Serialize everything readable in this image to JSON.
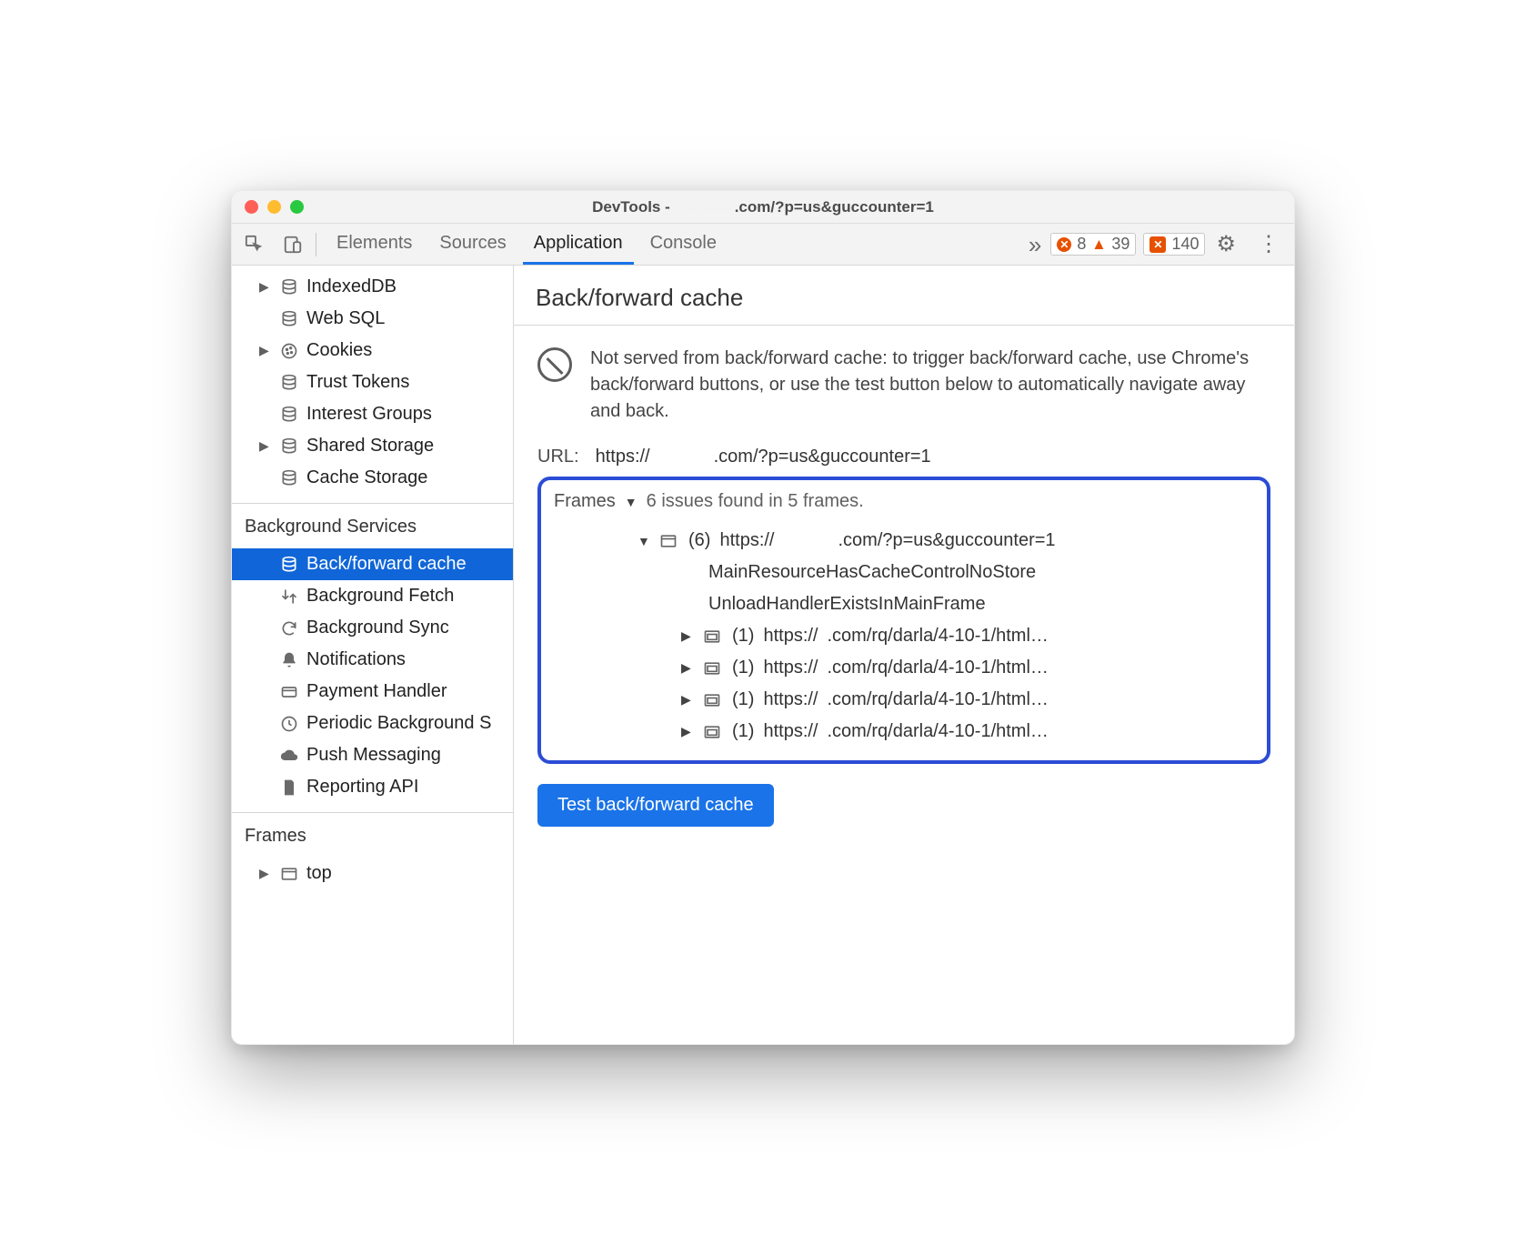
{
  "titlebar": {
    "prefix": "DevTools - ",
    "hidden_host": "xxxxxxx",
    "suffix": ".com/?p=us&guccounter=1"
  },
  "toolbar": {
    "tabs": [
      "Elements",
      "Sources",
      "Application",
      "Console"
    ],
    "active_tab": "Application",
    "counts": {
      "errors": "8",
      "warnings": "39",
      "messages": "140"
    }
  },
  "sidebar": {
    "storage_items": [
      {
        "label": "IndexedDB",
        "icon": "db",
        "expandable": true
      },
      {
        "label": "Web SQL",
        "icon": "db",
        "expandable": false
      },
      {
        "label": "Cookies",
        "icon": "cookie",
        "expandable": true
      },
      {
        "label": "Trust Tokens",
        "icon": "db",
        "expandable": false
      },
      {
        "label": "Interest Groups",
        "icon": "db",
        "expandable": false
      },
      {
        "label": "Shared Storage",
        "icon": "db",
        "expandable": true
      },
      {
        "label": "Cache Storage",
        "icon": "db",
        "expandable": false
      }
    ],
    "bg_section": "Background Services",
    "bg_items": [
      {
        "label": "Back/forward cache",
        "icon": "db",
        "selected": true
      },
      {
        "label": "Background Fetch",
        "icon": "fetch"
      },
      {
        "label": "Background Sync",
        "icon": "sync"
      },
      {
        "label": "Notifications",
        "icon": "bell"
      },
      {
        "label": "Payment Handler",
        "icon": "card"
      },
      {
        "label": "Periodic Background Sync",
        "icon": "clock",
        "truncate": "Periodic Background S"
      },
      {
        "label": "Push Messaging",
        "icon": "cloud"
      },
      {
        "label": "Reporting API",
        "icon": "doc"
      }
    ],
    "frames_section": "Frames",
    "frames_items": [
      {
        "label": "top",
        "icon": "frame",
        "expandable": true
      }
    ]
  },
  "content": {
    "title": "Back/forward cache",
    "notice": "Not served from back/forward cache: to trigger back/forward cache, use Chrome's back/forward buttons, or use the test button below to automatically navigate away and back.",
    "url_label": "URL:",
    "url_prefix": "https://",
    "url_hidden": "xxxxxxx",
    "url_suffix": ".com/?p=us&guccounter=1",
    "issues": {
      "frames_label": "Frames",
      "summary": "6 issues found in 5 frames.",
      "root": {
        "count": "(6)",
        "url_prefix": "https://",
        "url_hidden": "xxxxxxx",
        "url_suffix": ".com/?p=us&guccounter=1",
        "reasons": [
          "MainResourceHasCacheControlNoStore",
          "UnloadHandlerExistsInMainFrame"
        ],
        "children": [
          {
            "count": "(1)",
            "url_prefix": "https://",
            "url_hidden": "x",
            "url_suffix": ".com/rq/darla/4-10-1/html…"
          },
          {
            "count": "(1)",
            "url_prefix": "https://",
            "url_hidden": "x",
            "url_suffix": ".com/rq/darla/4-10-1/html…"
          },
          {
            "count": "(1)",
            "url_prefix": "https://",
            "url_hidden": "x",
            "url_suffix": ".com/rq/darla/4-10-1/html…"
          },
          {
            "count": "(1)",
            "url_prefix": "https://",
            "url_hidden": "x",
            "url_suffix": ".com/rq/darla/4-10-1/html…"
          }
        ]
      }
    },
    "button": "Test back/forward cache"
  }
}
